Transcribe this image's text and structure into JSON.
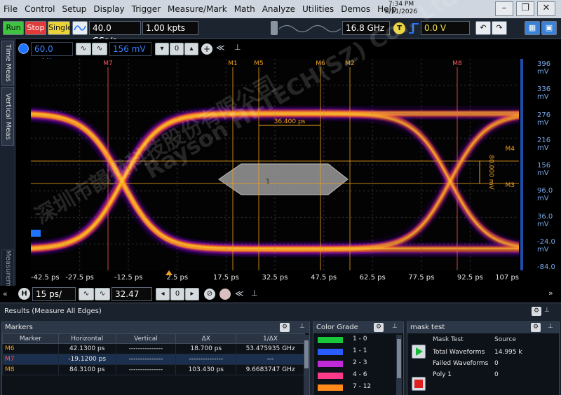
{
  "menu": [
    "File",
    "Control",
    "Setup",
    "Display",
    "Trigger",
    "Measure/Mark",
    "Math",
    "Analyze",
    "Utilities",
    "Demos",
    "Help"
  ],
  "clock": {
    "time": "7:34 PM",
    "date": "8/31/2026"
  },
  "window_controls": {
    "minimize": "–",
    "restore": "❐",
    "close": "✕"
  },
  "toolbar": {
    "run": "Run",
    "stop": "Stop",
    "single": "Single",
    "sample_rate": "40.0 GSa/s",
    "memory": "1.00 kpts",
    "bandwidth": "16.8 GHz",
    "trigger_badge": "T",
    "trigger_level": "0.0 V"
  },
  "sidetabs": [
    "Time Meas",
    "Vertical Meas",
    "Measurements"
  ],
  "scope_toolbar": {
    "channel_scale": "60.0 mV/",
    "channel_offset": "156 mV"
  },
  "markers_top": [
    "M7",
    "M1",
    "M5",
    "M6",
    "M2",
    "M8"
  ],
  "marker_right": [
    "M4",
    "M3"
  ],
  "delta_x_label": "36.400 ps",
  "delta_y_label": "80.000 mV",
  "mask_label": "1",
  "y_ticks": [
    "396 mV",
    "336 mV",
    "276 mV",
    "216 mV",
    "156 mV",
    "96.0 mV",
    "36.0 mV",
    "-24.0 mV",
    "-84.0 mV"
  ],
  "x_ticks": [
    "-42.5 ps",
    "-27.5 ps",
    "-12.5 ps",
    "2.5 ps",
    "17.5 ps",
    "32.5 ps",
    "47.5 ps",
    "62.5 ps",
    "77.5 ps",
    "92.5 ps",
    "107 ps"
  ],
  "timebase": {
    "badge": "H",
    "scale": "15 ps/",
    "position": "32.47 ps"
  },
  "results_title": "Results (Measure All Edges)",
  "markers_panel": {
    "title": "Markers",
    "columns": [
      "Marker",
      "Horizontal",
      "Vertical",
      "ΔX",
      "1/ΔX"
    ],
    "rows": [
      {
        "marker": "M6",
        "horizontal": "42.1300 ps",
        "vertical": "---------------",
        "dx": "18.700 ps",
        "inv_dx": "53.475935 GHz",
        "color": "#f0a020"
      },
      {
        "marker": "M7",
        "horizontal": "-19.1200 ps",
        "vertical": "---------------",
        "dx": "---------------",
        "inv_dx": "---",
        "color": "#ff5a5a"
      },
      {
        "marker": "M8",
        "horizontal": "84.3100 ps",
        "vertical": "---------------",
        "dx": "103.430 ps",
        "inv_dx": "9.6683747 GHz",
        "color": "#f0a020"
      }
    ]
  },
  "color_grade": {
    "title": "Color Grade",
    "rows": [
      {
        "label": "1 - 0",
        "color": "#18c83a"
      },
      {
        "label": "1 - 1",
        "color": "#2a5cff"
      },
      {
        "label": "2 - 3",
        "color": "#c02ad8"
      },
      {
        "label": "4 - 6",
        "color": "#ff3a8a"
      },
      {
        "label": "7 - 12",
        "color": "#ff8a1a"
      }
    ]
  },
  "mask_test": {
    "title": "mask test",
    "col1": "Mask Test",
    "col2": "Source",
    "rows": [
      {
        "label": "Total Waveforms",
        "value": "14.995 k"
      },
      {
        "label": "Failed Waveforms",
        "value": "0"
      },
      {
        "label": "Poly 1",
        "value": "0"
      }
    ]
  },
  "watermark": [
    "深圳市韻撥科技股份有限公司",
    "Rayson HI-TECH(SZ) Co., Ltd."
  ],
  "colors": {
    "accent": "#1e73ff",
    "trace_hot": "#ffd23a",
    "trace_mid": "#ff7a1a",
    "trace_cool": "#c030d8",
    "marker": "#ff9a2a"
  }
}
